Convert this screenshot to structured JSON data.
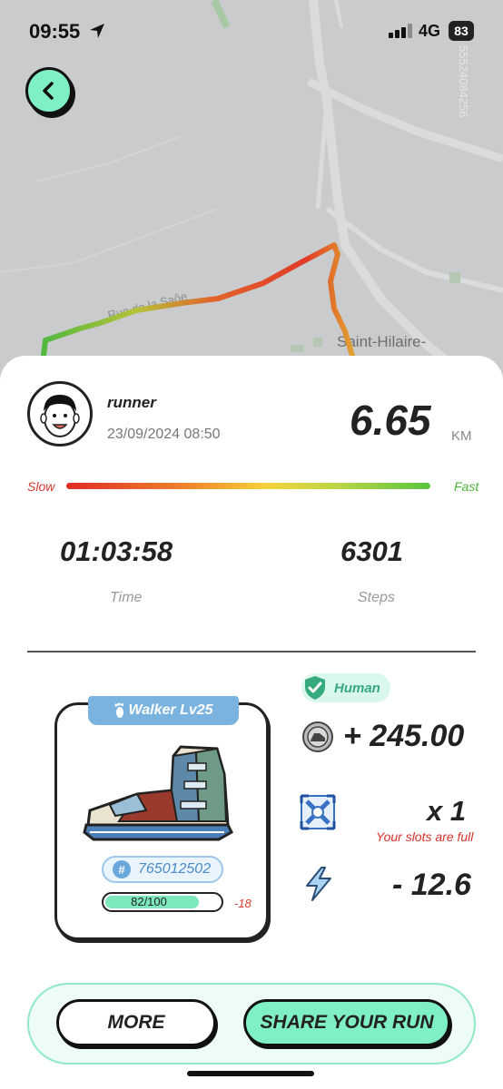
{
  "status_bar": {
    "time": "09:55",
    "network": "4G",
    "battery": "83"
  },
  "map": {
    "id_text": "55524084256",
    "street_label": "Rue de la Saôe",
    "town_label": "Saint-Hilaire-"
  },
  "profile": {
    "name": "runner",
    "datetime": "23/09/2024 08:50"
  },
  "distance": {
    "value": "6.65",
    "unit": "KM"
  },
  "speed_legend": {
    "slow": "Slow",
    "fast": "Fast"
  },
  "stats": {
    "time_value": "01:03:58",
    "time_label": "Time",
    "steps_value": "6301",
    "steps_label": "Steps"
  },
  "shoe": {
    "title": "Walker Lv25",
    "id": "765012502",
    "durability_text": "82/100",
    "durability_fraction": 0.82,
    "durability_delta": "-18"
  },
  "rewards": {
    "human_label": "Human",
    "tokens": "+ 245.00",
    "mystery_box": "x 1",
    "slots_note": "Your slots are full",
    "energy": "- 12.6"
  },
  "actions": {
    "more": "MORE",
    "share": "SHARE YOUR RUN"
  },
  "colors": {
    "accent": "#7ff0c3",
    "slow": "#d9372d",
    "fast": "#4fb23b",
    "shoe_blue": "#7ab3df"
  }
}
